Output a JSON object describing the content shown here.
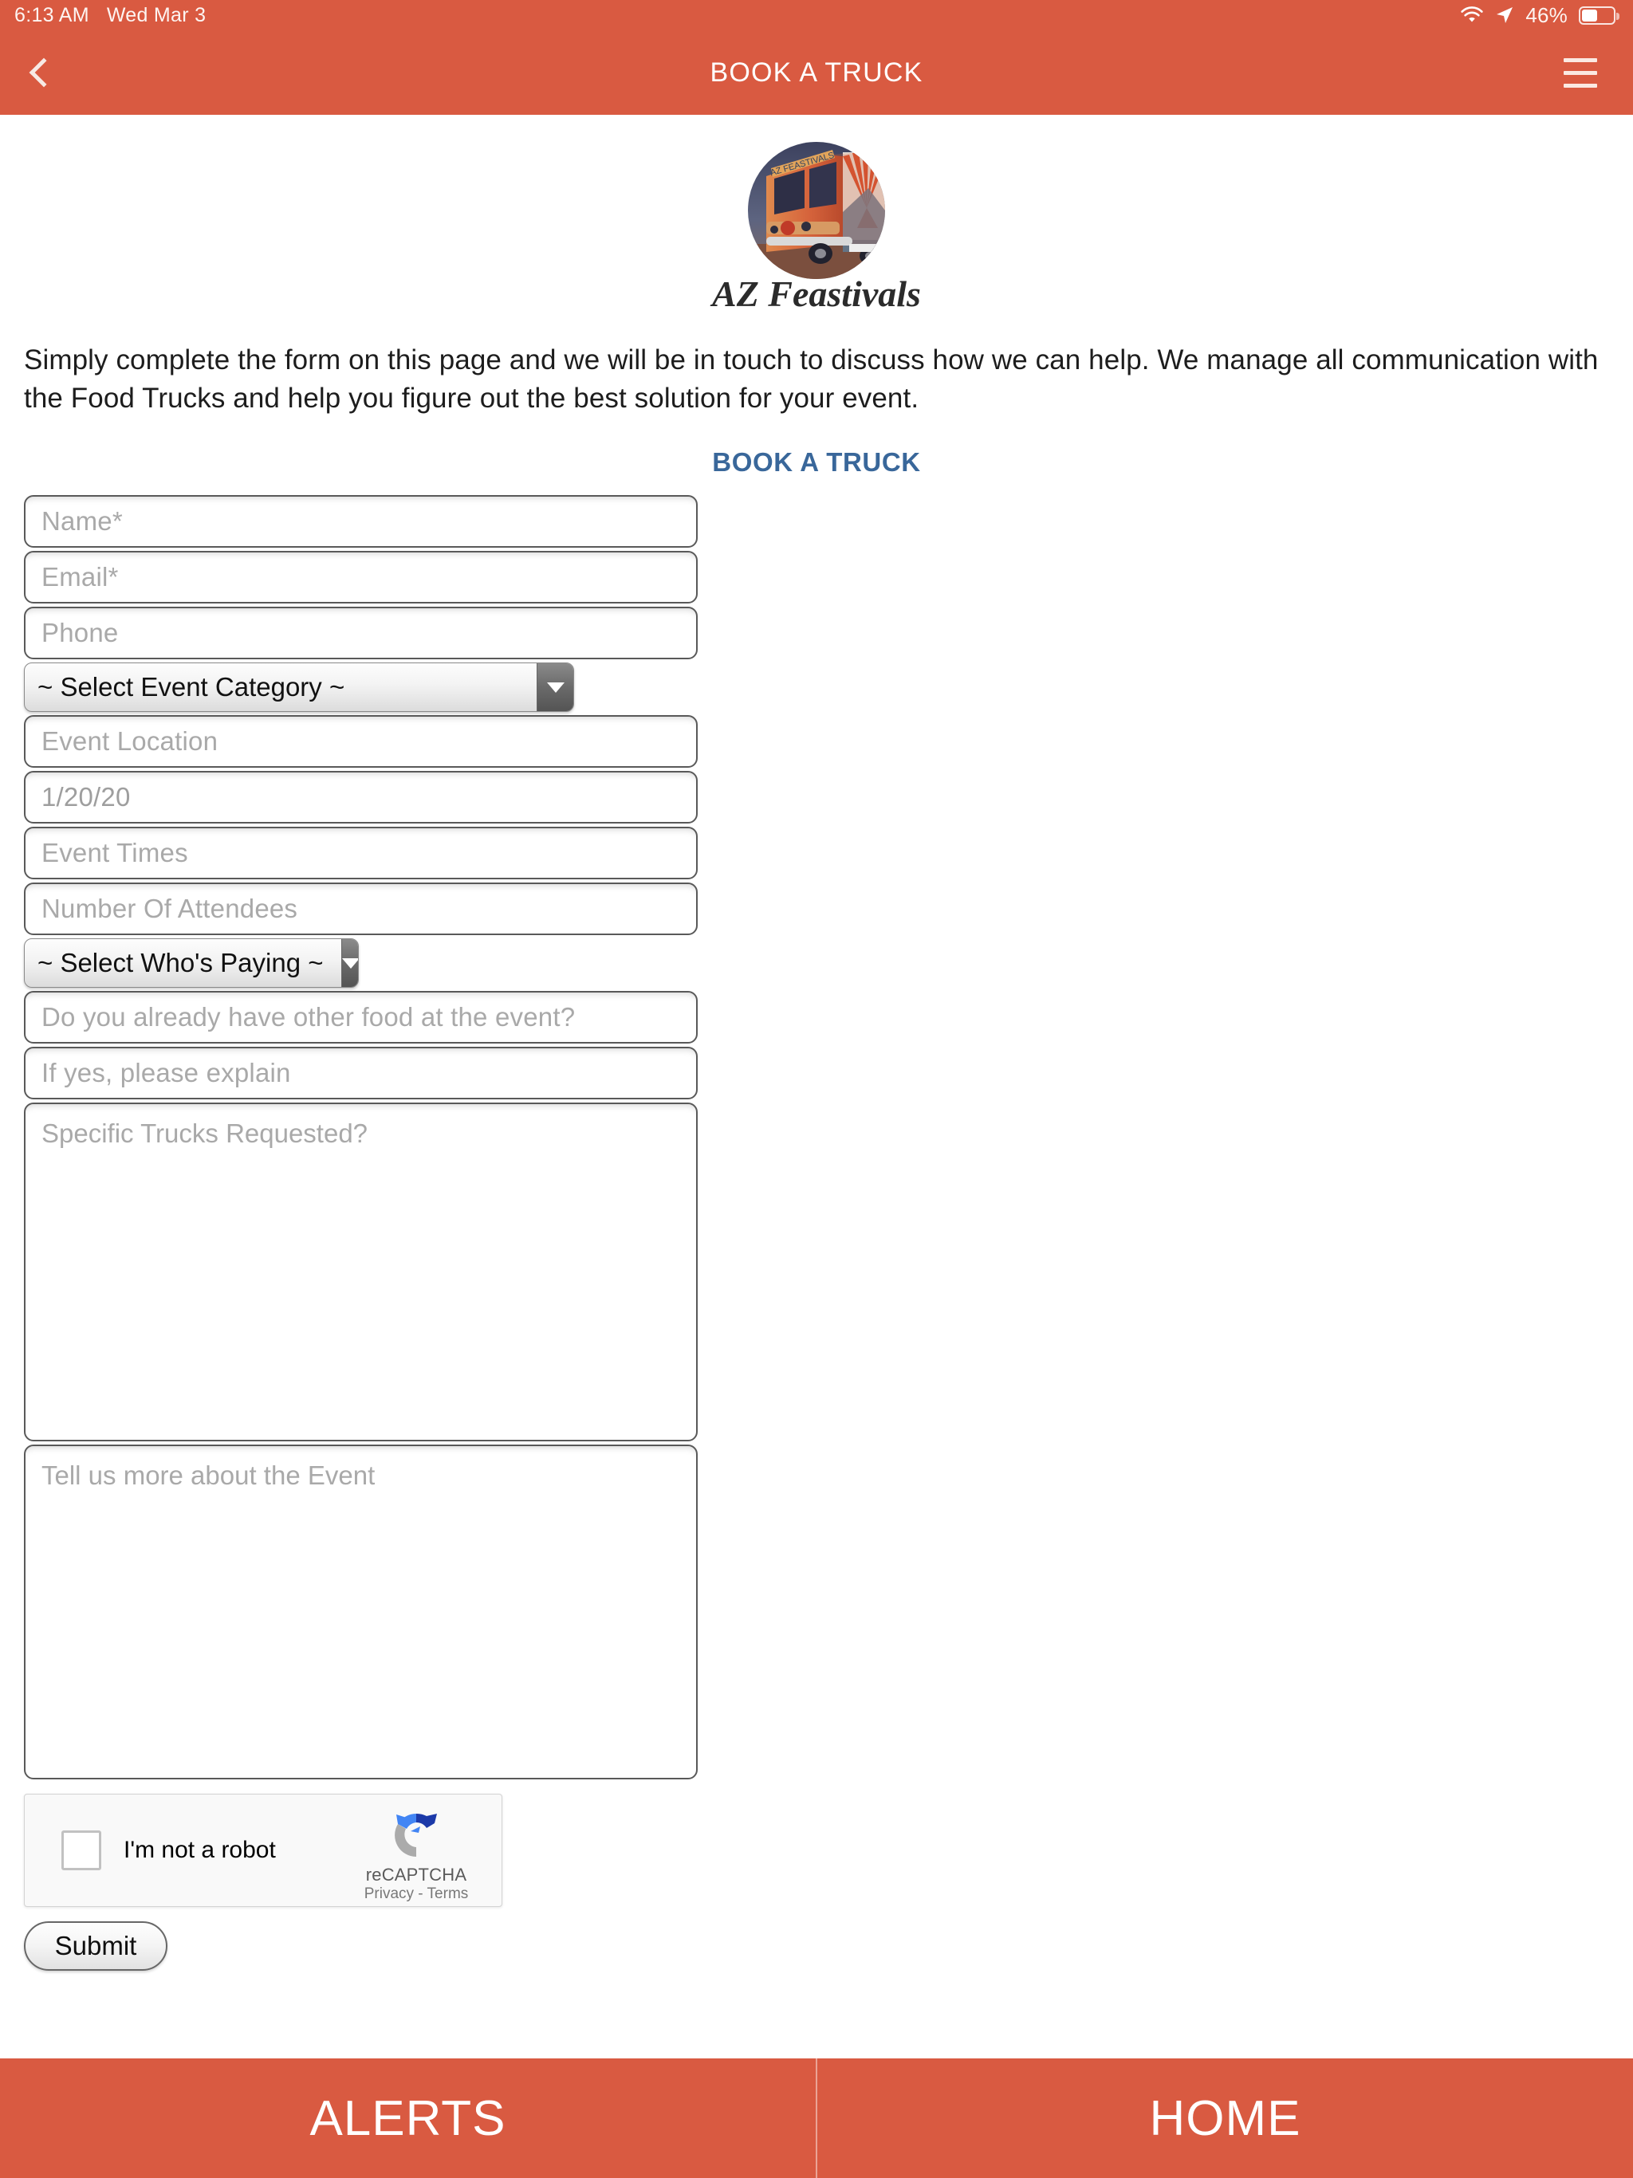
{
  "statusbar": {
    "time": "6:13 AM",
    "date": "Wed Mar 3",
    "battery_percent": "46%",
    "wifi_icon": "wifi-icon",
    "location_icon": "location-arrow-icon",
    "battery_icon": "battery-icon"
  },
  "navbar": {
    "title": "BOOK A TRUCK",
    "back_icon": "chevron-left-icon",
    "menu_icon": "hamburger-menu-icon",
    "background_color": "#D95A41"
  },
  "logo": {
    "alt": "AZ Feastivals food truck logo",
    "wordmark": "AZ Feastivals"
  },
  "intro": {
    "paragraph": "Simply complete the form on this page and we will be in touch to discuss how we can help. We manage all communication with the Food Trucks and help you figure out the best solution for your event."
  },
  "section": {
    "title": "BOOK A TRUCK",
    "title_color": "#39679A"
  },
  "form": {
    "fields": [
      {
        "name": "name",
        "placeholder": "Name*",
        "type": "text"
      },
      {
        "name": "email",
        "placeholder": "Email*",
        "type": "text"
      },
      {
        "name": "phone",
        "placeholder": "Phone",
        "type": "text"
      }
    ],
    "event_category_select": {
      "label": "~ Select Event Category ~",
      "arrow_icon": "chevron-down-icon"
    },
    "fields2": [
      {
        "name": "event-location",
        "placeholder": "Event Location",
        "type": "text"
      },
      {
        "name": "event-date",
        "placeholder": "1/20/20",
        "type": "date"
      },
      {
        "name": "event-times",
        "placeholder": "Event Times",
        "type": "text"
      },
      {
        "name": "attendees",
        "placeholder": "Number Of Attendees",
        "type": "text"
      }
    ],
    "who_paying_select": {
      "label": "~ Select Who's Paying ~",
      "arrow_icon": "chevron-down-icon"
    },
    "fields3": [
      {
        "name": "other-food",
        "placeholder": "Do you already have other food at the event?",
        "type": "text"
      },
      {
        "name": "explain",
        "placeholder": "If yes, please explain",
        "type": "text"
      }
    ],
    "textareas": [
      {
        "name": "specific-trucks",
        "placeholder": "Specific Trucks Requested?"
      },
      {
        "name": "about-event",
        "placeholder": "Tell us more about the Event"
      }
    ],
    "recaptcha": {
      "label": "I'm not a robot",
      "brand": "reCAPTCHA",
      "legal": "Privacy - Terms",
      "checkbox_icon": "checkbox-icon",
      "logo_icon": "recaptcha-logo-icon"
    },
    "submit_label": "Submit"
  },
  "tabbar": {
    "tabs": [
      {
        "name": "alerts",
        "label": "ALERTS"
      },
      {
        "name": "home",
        "label": "HOME"
      }
    ]
  }
}
